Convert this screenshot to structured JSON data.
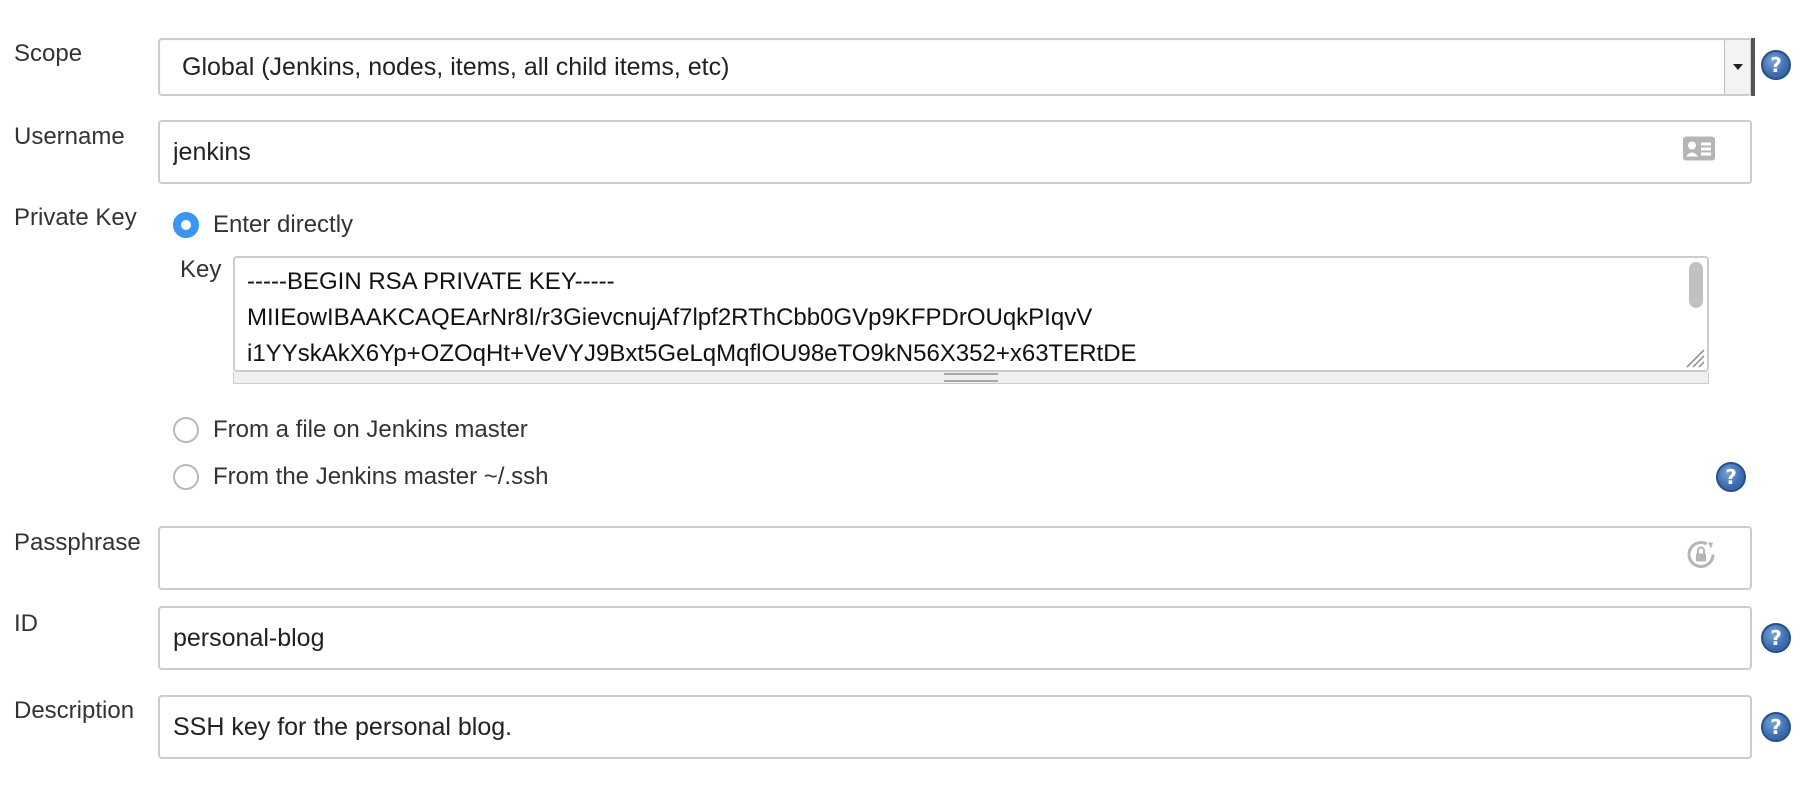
{
  "scope": {
    "label": "Scope",
    "selected": "Global (Jenkins, nodes, items, all child items, etc)"
  },
  "username": {
    "label": "Username",
    "value": "jenkins"
  },
  "private_key": {
    "label": "Private Key",
    "options": [
      {
        "label": "Enter directly",
        "checked": true
      },
      {
        "label": "From a file on Jenkins master",
        "checked": false
      },
      {
        "label": "From the Jenkins master ~/.ssh",
        "checked": false
      }
    ],
    "key_label": "Key",
    "key_lines": [
      "-----BEGIN RSA PRIVATE KEY-----",
      "MIIEowIBAAKCAQEArNr8I/r3GievcnujAf7lpf2RThCbb0GVp9KFPDrOUqkPIqvV",
      "i1YYskAkX6Yp+OZOqHt+VeVYJ9Bxt5GeLqMqflOU98eTO9kN56X352+x63TERtDE"
    ]
  },
  "passphrase": {
    "label": "Passphrase",
    "value": ""
  },
  "id": {
    "label": "ID",
    "value": "personal-blog"
  },
  "description": {
    "label": "Description",
    "value": "SSH key for the personal blog."
  },
  "help_symbol": "?",
  "colors": {
    "accent": "#3a96f3",
    "border": "#cccccc",
    "help_blue": "#3f6fb3"
  }
}
